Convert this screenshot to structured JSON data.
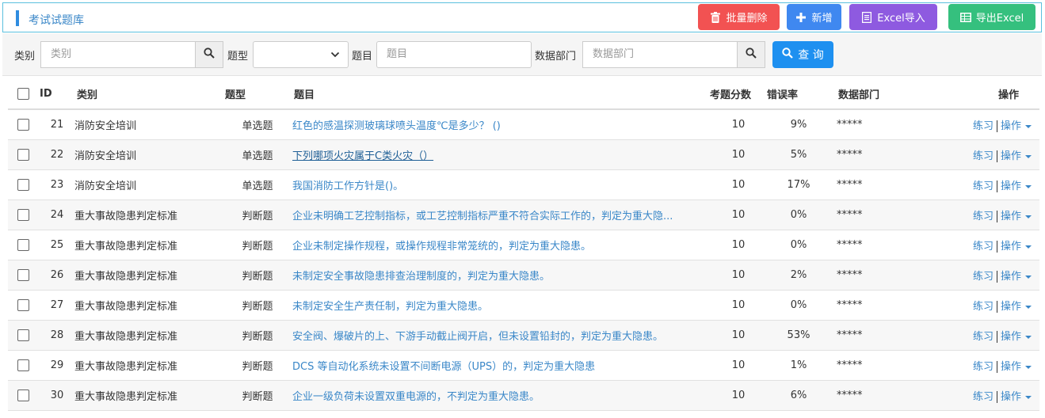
{
  "header": {
    "title": "考试试题库",
    "buttons": {
      "batch_delete": "批量删除",
      "add": "新增",
      "excel_import": "Excel导入",
      "excel_export": "导出Excel"
    },
    "colors": {
      "delete": "#f25252",
      "add": "#3f88f0",
      "import": "#8e5ae0",
      "export": "#35c07e"
    }
  },
  "filters": {
    "category_label": "类别",
    "category_placeholder": "类别",
    "type_label": "题型",
    "type_value": "",
    "question_label": "题目",
    "question_placeholder": "题目",
    "dept_label": "数据部门",
    "dept_placeholder": "数据部门",
    "query_button": "查 询"
  },
  "table": {
    "columns": {
      "id": "ID",
      "category": "类别",
      "type": "题型",
      "question": "题目",
      "score": "考题分数",
      "error_rate": "错误率",
      "dept": "数据部门",
      "actions": "操作"
    },
    "practice_label": "练习",
    "actions_label": "操作",
    "rows": [
      {
        "id": "21",
        "category": "消防安全培训",
        "type": "单选题",
        "question": "红色的感温探测玻璃球喷头温度℃是多少？ ()",
        "score": "10",
        "error_rate": "9%",
        "dept": "*****"
      },
      {
        "id": "22",
        "category": "消防安全培训",
        "type": "单选题",
        "question": "下列哪项火灾属于C类火灾（）",
        "score": "10",
        "error_rate": "5%",
        "dept": "*****"
      },
      {
        "id": "23",
        "category": "消防安全培训",
        "type": "单选题",
        "question": "我国消防工作方针是()。",
        "score": "10",
        "error_rate": "17%",
        "dept": "*****"
      },
      {
        "id": "24",
        "category": "重大事故隐患判定标准",
        "type": "判断题",
        "question": "企业未明确工艺控制指标，或工艺控制指标严重不符合实际工作的，判定为重大隐...",
        "score": "10",
        "error_rate": "0%",
        "dept": "*****"
      },
      {
        "id": "25",
        "category": "重大事故隐患判定标准",
        "type": "判断题",
        "question": "企业未制定操作规程，或操作规程非常笼统的，判定为重大隐患。",
        "score": "10",
        "error_rate": "0%",
        "dept": "*****"
      },
      {
        "id": "26",
        "category": "重大事故隐患判定标准",
        "type": "判断题",
        "question": "未制定安全事故隐患排查治理制度的，判定为重大隐患。",
        "score": "10",
        "error_rate": "2%",
        "dept": "*****"
      },
      {
        "id": "27",
        "category": "重大事故隐患判定标准",
        "type": "判断题",
        "question": "未制定安全生产责任制，判定为重大隐患。",
        "score": "10",
        "error_rate": "0%",
        "dept": "*****"
      },
      {
        "id": "28",
        "category": "重大事故隐患判定标准",
        "type": "判断题",
        "question": "安全阀、爆破片的上、下游手动截止阀开启，但未设置铅封的，判定为重大隐患。",
        "score": "10",
        "error_rate": "53%",
        "dept": "*****"
      },
      {
        "id": "29",
        "category": "重大事故隐患判定标准",
        "type": "判断题",
        "question": "DCS 等自动化系统未设置不间断电源（UPS）的，判定为重大隐患",
        "score": "10",
        "error_rate": "1%",
        "dept": "*****"
      },
      {
        "id": "30",
        "category": "重大事故隐患判定标准",
        "type": "判断题",
        "question": "企业一级负荷未设置双重电源的，不判定为重大隐患。",
        "score": "10",
        "error_rate": "6%",
        "dept": "*****"
      }
    ]
  }
}
